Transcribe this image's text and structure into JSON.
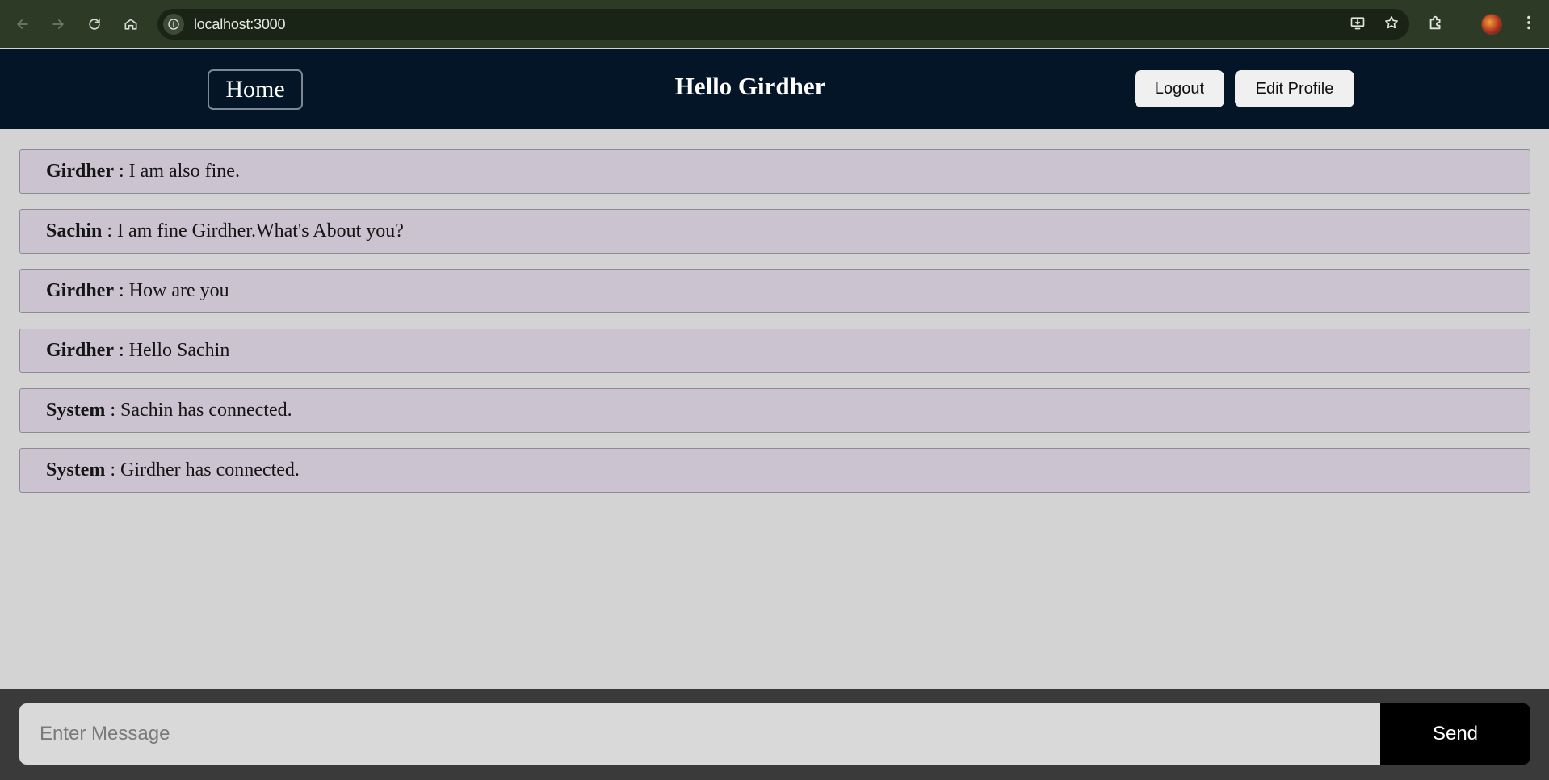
{
  "browser": {
    "url": "localhost:3000",
    "icons": {
      "back": "arrow-left-icon",
      "forward": "arrow-right-icon",
      "reload": "reload-icon",
      "home": "home-icon",
      "site_info": "info-icon",
      "install": "install-app-icon",
      "bookmark": "star-icon",
      "extensions": "puzzle-icon",
      "profile": "avatar",
      "menu": "kebab-menu-icon"
    }
  },
  "header": {
    "home_label": "Home",
    "title": "Hello Girdher",
    "logout_label": "Logout",
    "edit_profile_label": "Edit Profile"
  },
  "messages": [
    {
      "sender": "Girdher",
      "text": "I am also fine."
    },
    {
      "sender": "Sachin",
      "text": "I am fine Girdher.What's About you?"
    },
    {
      "sender": "Girdher",
      "text": "How are you"
    },
    {
      "sender": "Girdher",
      "text": "Hello Sachin"
    },
    {
      "sender": "System",
      "text": "Sachin has connected."
    },
    {
      "sender": "System",
      "text": "Girdher has connected."
    }
  ],
  "composer": {
    "placeholder": "Enter Message",
    "value": "",
    "send_label": "Send"
  },
  "colors": {
    "header_bg": "#041527",
    "page_bg": "#d3d3d3",
    "message_bg": "#cbc3d0",
    "composer_bg": "#3a3a3a",
    "send_bg": "#000000"
  }
}
